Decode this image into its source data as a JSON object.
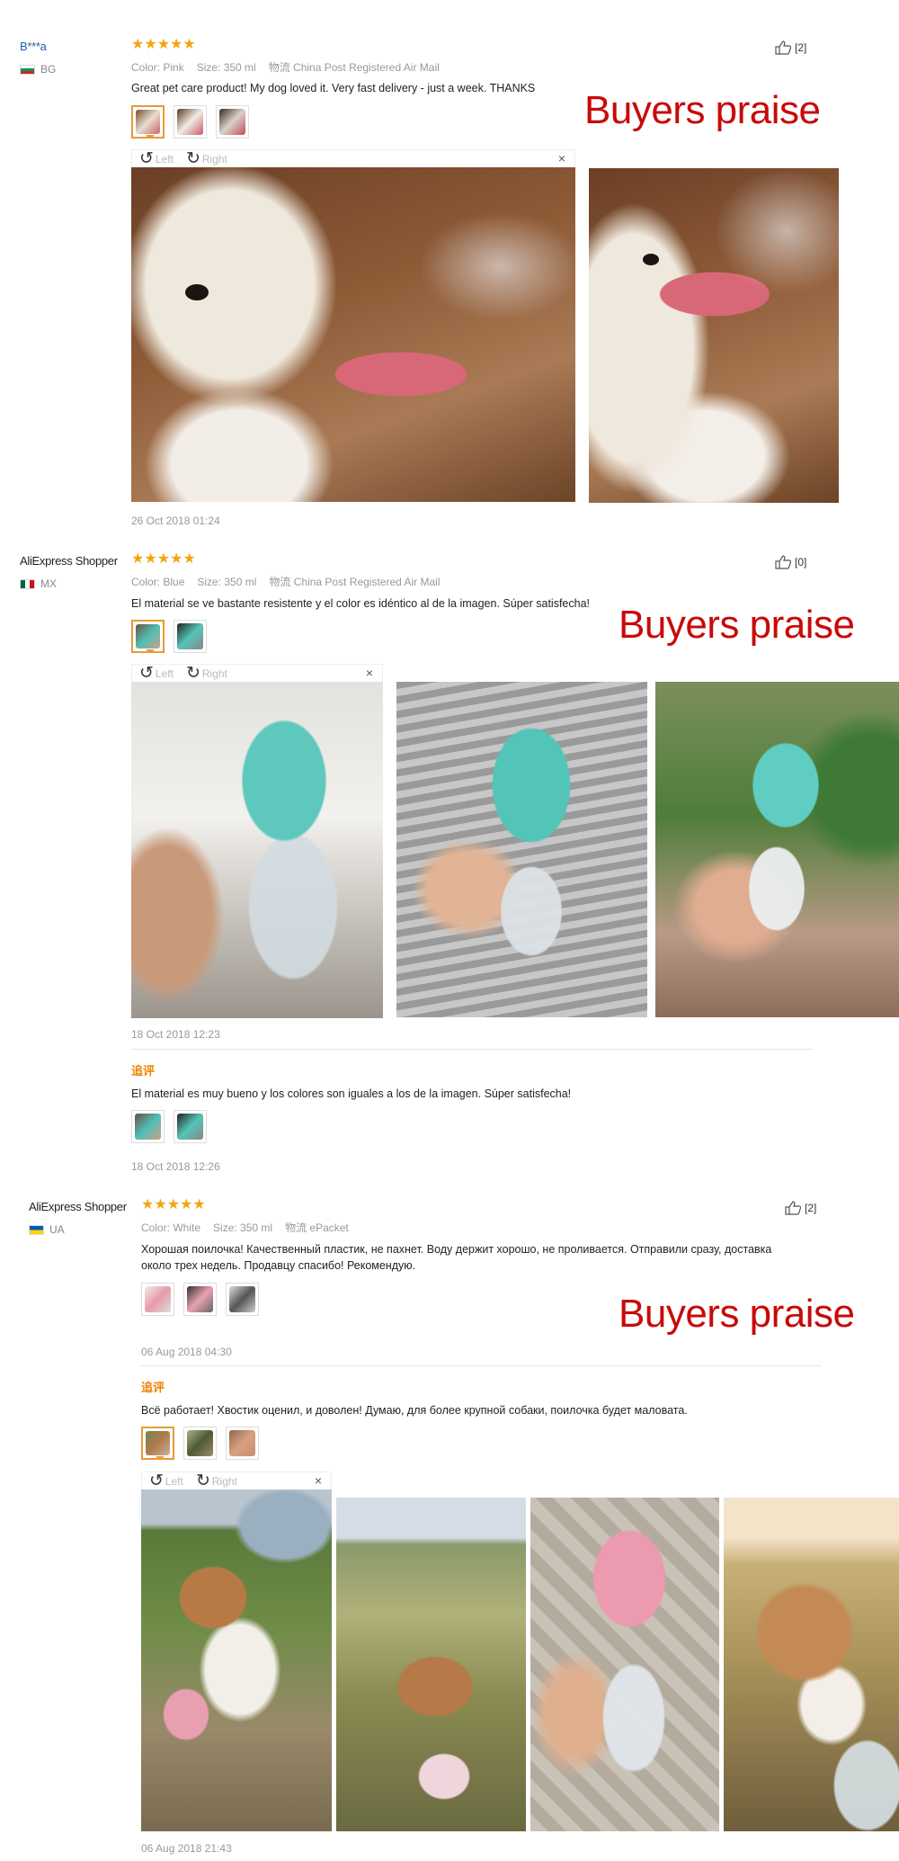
{
  "reviews": [
    {
      "user": "B***a",
      "country": "BG",
      "stars": "★★★★★",
      "color": "Color: Pink",
      "size": "Size: 350 ml",
      "shipping": "物流 China Post Registered Air Mail",
      "text": "Great pet care product! My dog loved it. Very fast delivery - just a week. THANKS",
      "useful": "[2]",
      "date": "26 Oct 2018 01:24",
      "praise": "Buyers praise",
      "rotate_left": "Left",
      "rotate_right": "Right",
      "close": "×"
    },
    {
      "user": "AliExpress Shopper",
      "country": "MX",
      "stars": "★★★★★",
      "color": "Color: Blue",
      "size": "Size: 350 ml",
      "shipping": "物流 China Post Registered Air Mail",
      "text": "El material se ve bastante resistente y el color es idéntico al de la imagen. Súper satisfecha!",
      "useful": "[0]",
      "date": "18 Oct 2018 12:23",
      "praise": "Buyers praise",
      "rotate_left": "Left",
      "rotate_right": "Right",
      "close": "×",
      "additional_label": "追评",
      "additional_text": "El material es muy bueno y los colores son iguales a los de la imagen. Súper satisfecha!",
      "additional_date": "18 Oct 2018 12:26"
    },
    {
      "user": "AliExpress Shopper",
      "country": "UA",
      "stars": "★★★★★",
      "color": "Color: White",
      "size": "Size: 350 ml",
      "shipping": "物流 ePacket",
      "text_line1": "Хорошая поилочка! Качественный пластик, не пахнет. Воду держит хорошо, не проливается. Отправили сразу, доставка",
      "text_line2": "около трех недель. Продавцу спасибо! Рекомендую.",
      "useful": "[2]",
      "date": "06 Aug 2018 04:30",
      "praise": "Buyers praise",
      "additional_label": "追评",
      "additional_text": "Всё работает! Хвостик оценил, и доволен! Думаю, для более крупной собаки, поилочка будет маловата.",
      "rotate_left": "Left",
      "rotate_right": "Right",
      "close": "×",
      "additional_date": "06 Aug 2018 21:43"
    }
  ],
  "colors": {
    "star": "#f5a40e",
    "praise": "#c80a0a",
    "additional_label": "#f08200",
    "active_thumb_border": "#e69a36"
  },
  "icons": [
    "thumbs-up-icon",
    "rotate-left-icon",
    "rotate-right-icon",
    "close-icon",
    "star-icon",
    "flag-icon"
  ]
}
